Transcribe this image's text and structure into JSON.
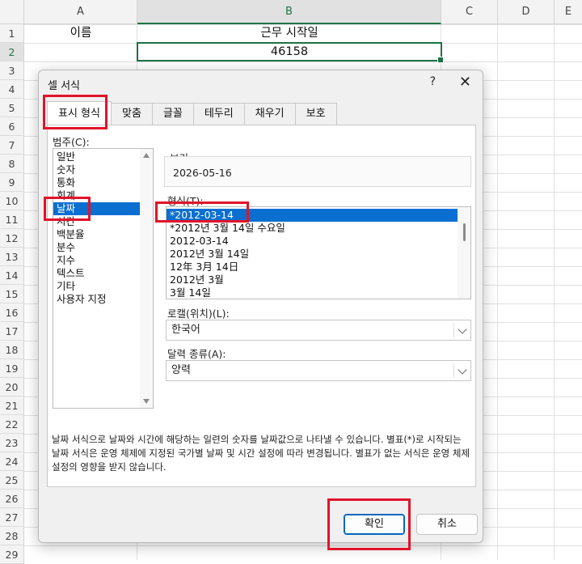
{
  "sheet": {
    "columns": [
      {
        "label": "A",
        "width": 140,
        "selected": false
      },
      {
        "label": "B",
        "width": 376,
        "selected": true
      },
      {
        "label": "C",
        "width": 70,
        "selected": false
      },
      {
        "label": "D",
        "width": 70,
        "selected": false
      },
      {
        "label": "E",
        "width": 34,
        "selected": false
      }
    ],
    "rows": [
      "1",
      "2",
      "3",
      "4",
      "5",
      "6",
      "7",
      "8",
      "9",
      "10",
      "11",
      "12",
      "13",
      "14",
      "15",
      "16",
      "17",
      "18",
      "19",
      "20",
      "21",
      "22",
      "23",
      "24",
      "25",
      "26",
      "27",
      "28",
      "29"
    ],
    "selected_row": "2",
    "cells": {
      "A1": "이름",
      "B1": "근무 시작일",
      "B2": "46158"
    },
    "accent_color": "#1e7145"
  },
  "dialog": {
    "title": "셀 서식",
    "help": "?",
    "close": "✕",
    "tabs": [
      {
        "label": "표시 형식",
        "active": true
      },
      {
        "label": "맞춤",
        "active": false
      },
      {
        "label": "글꼴",
        "active": false
      },
      {
        "label": "테두리",
        "active": false
      },
      {
        "label": "채우기",
        "active": false
      },
      {
        "label": "보호",
        "active": false
      }
    ],
    "category_label": "범주(C):",
    "categories": [
      {
        "label": "일반",
        "selected": false
      },
      {
        "label": "숫자",
        "selected": false
      },
      {
        "label": "통화",
        "selected": false
      },
      {
        "label": "회계",
        "selected": false
      },
      {
        "label": "날짜",
        "selected": true
      },
      {
        "label": "시간",
        "selected": false
      },
      {
        "label": "백분율",
        "selected": false
      },
      {
        "label": "분수",
        "selected": false
      },
      {
        "label": "지수",
        "selected": false
      },
      {
        "label": "텍스트",
        "selected": false
      },
      {
        "label": "기타",
        "selected": false
      },
      {
        "label": "사용자 지정",
        "selected": false
      }
    ],
    "preview_label": "보기",
    "preview_value": "2026-05-16",
    "type_label": "형식(T):",
    "types": [
      {
        "label": "*2012-03-14",
        "selected": true
      },
      {
        "label": "*2012년 3월 14일 수요일",
        "selected": false
      },
      {
        "label": "2012-03-14",
        "selected": false
      },
      {
        "label": "2012년 3월 14일",
        "selected": false
      },
      {
        "label": "12年 3月 14日",
        "selected": false
      },
      {
        "label": "2012년 3월",
        "selected": false
      },
      {
        "label": "3월 14일",
        "selected": false
      }
    ],
    "locale_label": "로캘(위치)(L):",
    "locale_value": "한국어",
    "calendar_label": "달력 종류(A):",
    "calendar_value": "양력",
    "description": "날짜 서식으로 날짜와 시간에 해당하는 일련의 숫자를 날짜값으로 나타낼 수 있습니다. 별표(*)로 시작되는 날짜 서식은 운영 체제에 지정된 국가별 날짜 및 시간 설정에 따라 변경됩니다. 별표가 없는 서식은 운영 체제 설정의 영향을 받지 않습니다.",
    "ok_label": "확인",
    "cancel_label": "취소",
    "selection_color": "#0a6fd1"
  },
  "highlight_color": "#e0142a"
}
